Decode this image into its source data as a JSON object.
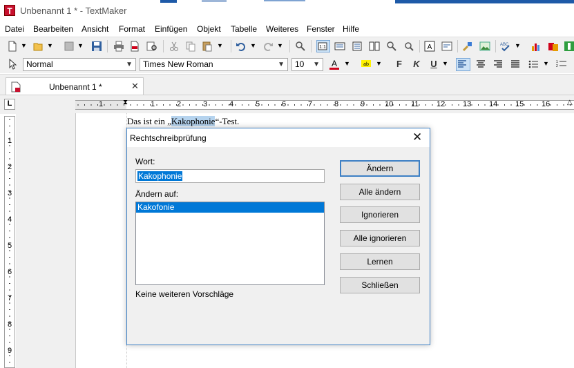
{
  "window": {
    "title": "Unbenannt 1 * - TextMaker"
  },
  "menu": [
    "Datei",
    "Bearbeiten",
    "Ansicht",
    "Format",
    "Einfügen",
    "Objekt",
    "Tabelle",
    "Weiteres",
    "Fenster",
    "Hilfe"
  ],
  "format_bar": {
    "style": "Normal",
    "font": "Times New Roman",
    "size": "10",
    "bold": "F",
    "italic": "K",
    "underline": "U"
  },
  "tab": {
    "label": "Unbenannt 1 *"
  },
  "ruler": {
    "h_numbers": [
      "1",
      "1",
      "2",
      "3",
      "4",
      "5",
      "6",
      "7",
      "8",
      "9",
      "10",
      "11",
      "12",
      "13",
      "14",
      "15",
      "16"
    ],
    "v_numbers": [
      "1",
      "2",
      "3",
      "4",
      "5",
      "6",
      "7",
      "8",
      "9"
    ]
  },
  "document": {
    "text_before": "Das ist ein „",
    "highlighted_word": "Kakophonie",
    "text_after": "“-Test."
  },
  "dialog": {
    "title": "Rechtschreibprüfung",
    "word_label": "Wort:",
    "word_value": "Kakophonie",
    "change_to_label": "Ändern auf:",
    "suggestions": [
      "Kakofonie"
    ],
    "no_more": "Keine weiteren Vorschläge",
    "buttons": {
      "change": "Ändern",
      "change_all": "Alle ändern",
      "ignore": "Ignorieren",
      "ignore_all": "Alle ignorieren",
      "learn": "Lernen",
      "close": "Schließen"
    }
  },
  "colors": {
    "accent": "#0078d7",
    "dialog_border": "#3c7fc4",
    "app_icon": "#c8102e",
    "selection_highlight": "#b5d3ee"
  },
  "icons": [
    "new-doc-icon",
    "open-folder-icon",
    "save-icon",
    "print-icon",
    "pdf-icon",
    "undo-icon",
    "redo-icon",
    "search-icon",
    "spellcheck-icon",
    "chart-icon"
  ]
}
